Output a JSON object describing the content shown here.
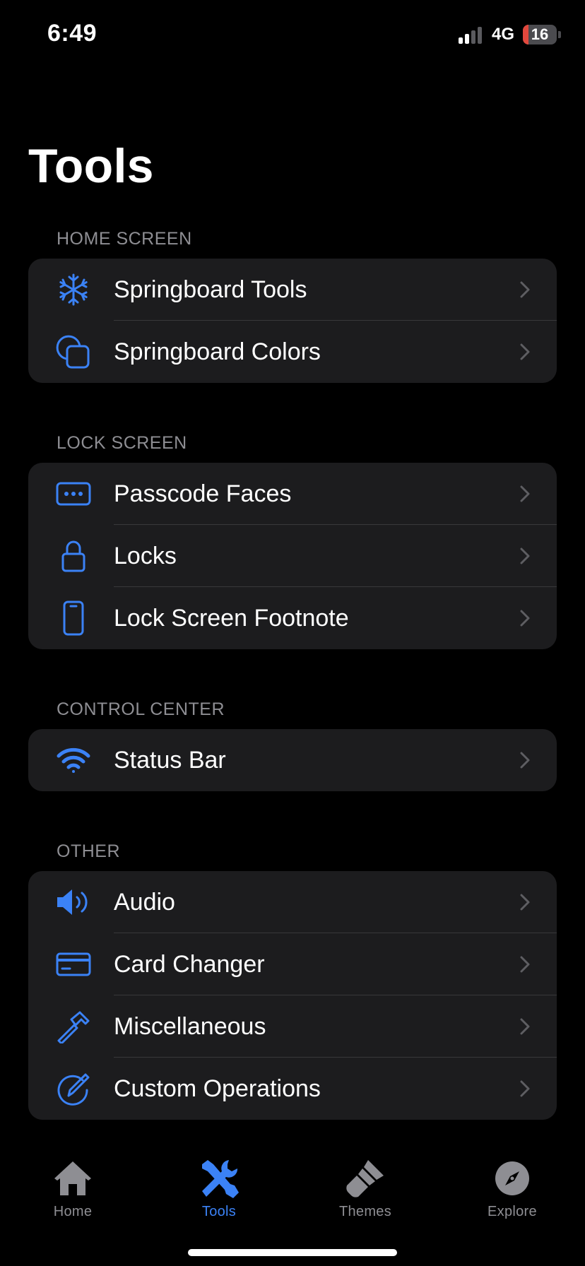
{
  "status_bar": {
    "time": "6:49",
    "network": "4G",
    "battery_level": "16",
    "battery_fraction": 0.16,
    "battery_color": "#e2483d"
  },
  "title": "Tools",
  "accent_color": "#3b82f6",
  "sections": [
    {
      "header": "HOME SCREEN",
      "items": [
        {
          "label": "Springboard Tools",
          "icon": "snowflake-icon"
        },
        {
          "label": "Springboard Colors",
          "icon": "overlapping-squares-icon"
        }
      ]
    },
    {
      "header": "LOCK SCREEN",
      "items": [
        {
          "label": "Passcode Faces",
          "icon": "passcode-dots-icon"
        },
        {
          "label": "Locks",
          "icon": "lock-icon"
        },
        {
          "label": "Lock Screen Footnote",
          "icon": "iphone-icon"
        }
      ]
    },
    {
      "header": "CONTROL CENTER",
      "items": [
        {
          "label": "Status Bar",
          "icon": "wifi-icon"
        }
      ]
    },
    {
      "header": "OTHER",
      "items": [
        {
          "label": "Audio",
          "icon": "speaker-icon"
        },
        {
          "label": "Card Changer",
          "icon": "credit-card-icon"
        },
        {
          "label": "Miscellaneous",
          "icon": "hammer-icon"
        },
        {
          "label": "Custom Operations",
          "icon": "pencil-circle-icon"
        }
      ]
    }
  ],
  "tab_bar": {
    "tabs": [
      {
        "label": "Home",
        "icon": "house-icon",
        "active": false
      },
      {
        "label": "Tools",
        "icon": "wrench-screwdriver-icon",
        "active": true
      },
      {
        "label": "Themes",
        "icon": "paintbrush-icon",
        "active": false
      },
      {
        "label": "Explore",
        "icon": "compass-icon",
        "active": false
      }
    ]
  }
}
